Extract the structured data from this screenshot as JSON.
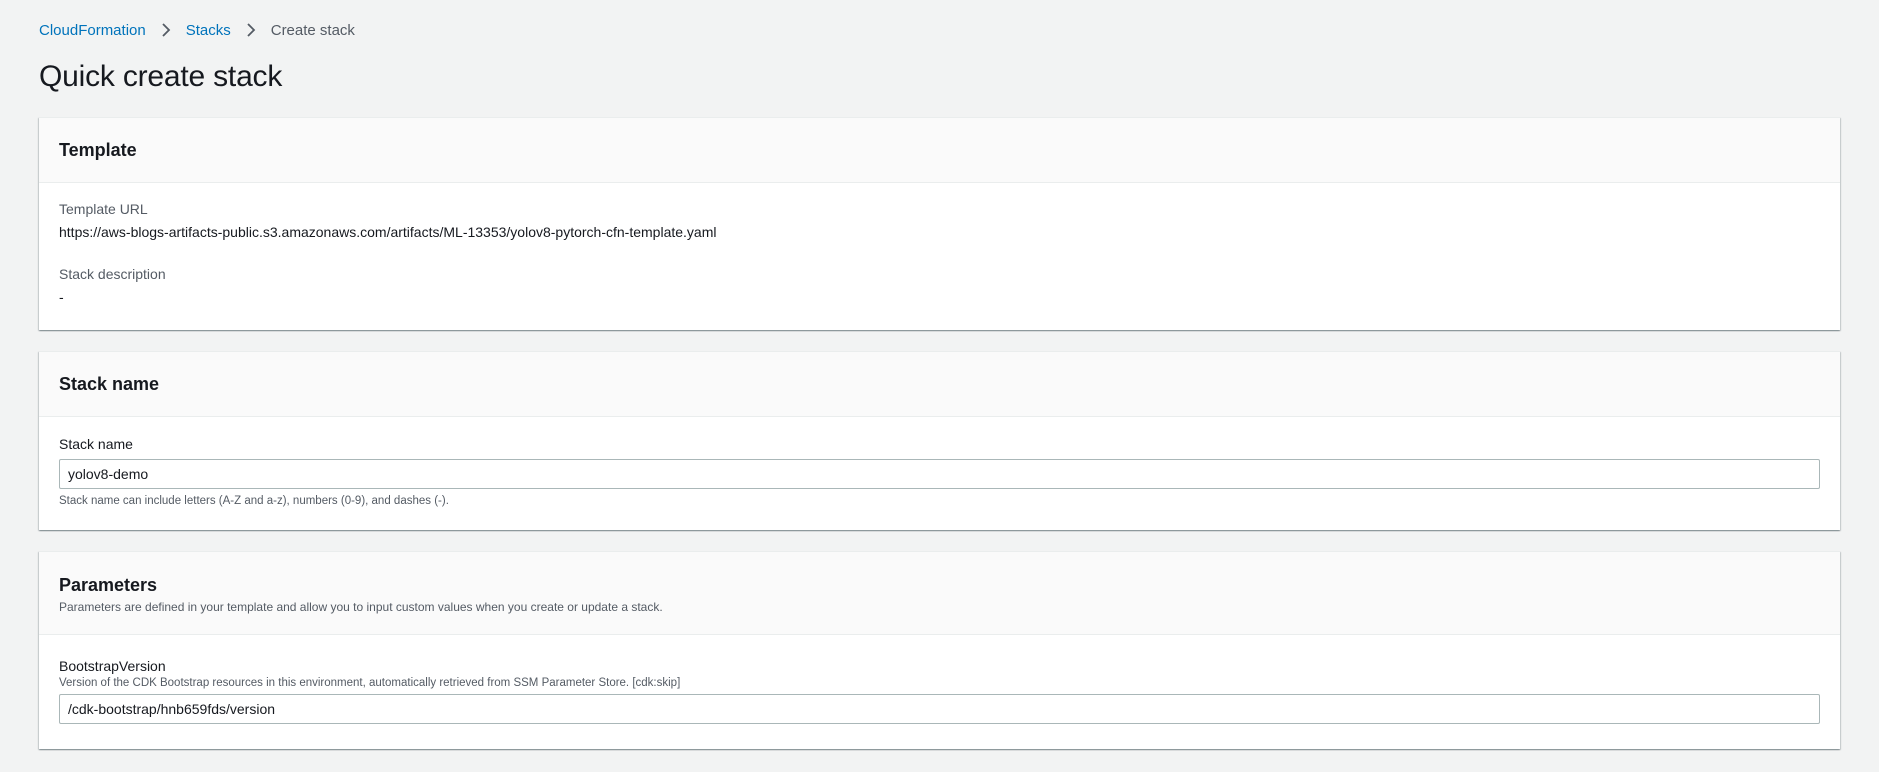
{
  "breadcrumb": {
    "items": [
      {
        "label": "CloudFormation"
      },
      {
        "label": "Stacks"
      },
      {
        "label": "Create stack"
      }
    ]
  },
  "page": {
    "title": "Quick create stack"
  },
  "template_panel": {
    "title": "Template",
    "url_label": "Template URL",
    "url_value": "https://aws-blogs-artifacts-public.s3.amazonaws.com/artifacts/ML-13353/yolov8-pytorch-cfn-template.yaml",
    "desc_label": "Stack description",
    "desc_value": "-"
  },
  "stack_name_panel": {
    "title": "Stack name",
    "field_label": "Stack name",
    "field_value": "yolov8-demo",
    "help": "Stack name can include letters (A-Z and a-z), numbers (0-9), and dashes (-)."
  },
  "parameters_panel": {
    "title": "Parameters",
    "description": "Parameters are defined in your template and allow you to input custom values when you create or update a stack.",
    "params": [
      {
        "label": "BootstrapVersion",
        "help": "Version of the CDK Bootstrap resources in this environment, automatically retrieved from SSM Parameter Store. [cdk:skip]",
        "value": "/cdk-bootstrap/hnb659fds/version"
      }
    ]
  },
  "icons": {
    "breadcrumb_separator": "chevron-right-icon"
  },
  "colors": {
    "link": "#0073bb",
    "background": "#f2f3f3",
    "text": "#16191f",
    "secondary_text": "#545b64"
  }
}
